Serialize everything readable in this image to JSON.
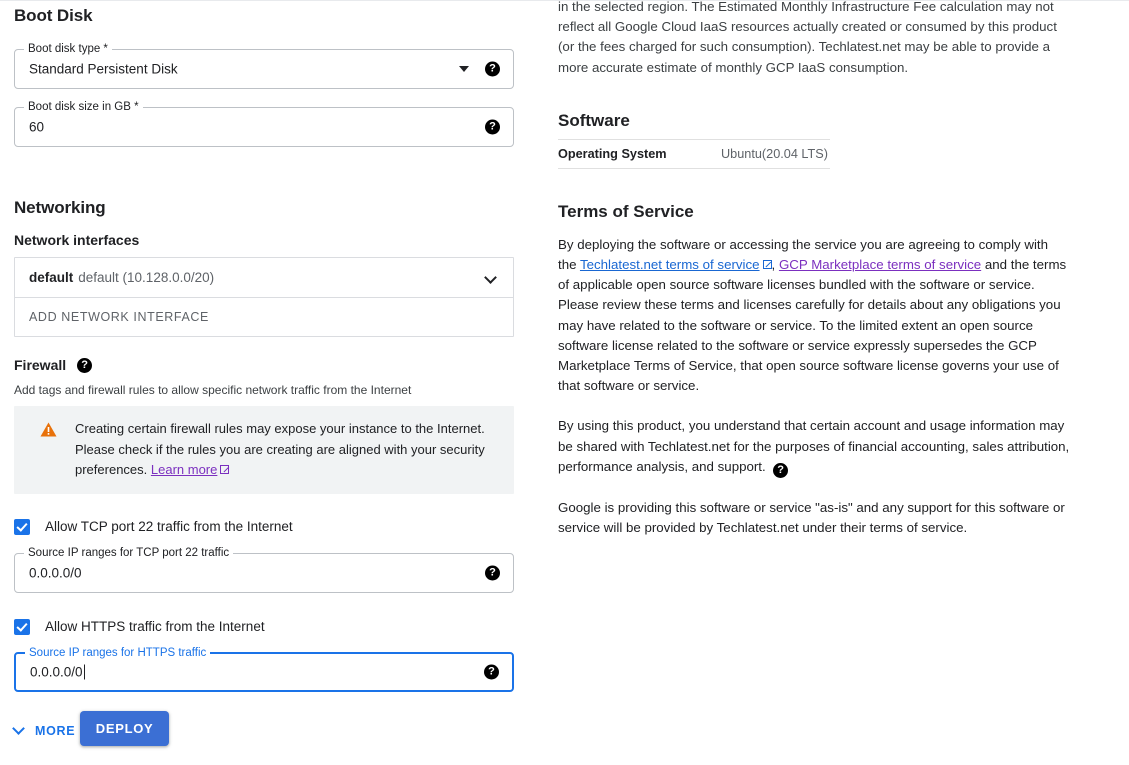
{
  "left": {
    "boot_disk": {
      "heading": "Boot Disk",
      "type_field": {
        "label": "Boot disk type *",
        "value": "Standard Persistent Disk",
        "help": "?"
      },
      "size_field": {
        "label": "Boot disk size in GB *",
        "value": "60",
        "help": "?"
      }
    },
    "networking": {
      "heading": "Networking",
      "interfaces_label": "Network interfaces",
      "interface_name": "default",
      "interface_detail": "default (10.128.0.0/20)",
      "add_interface_label": "ADD NETWORK INTERFACE",
      "firewall_label": "Firewall",
      "firewall_help": "?",
      "firewall_helper": "Add tags and firewall rules to allow specific network traffic from the Internet",
      "warning": {
        "text_before": "Creating certain firewall rules may expose your instance to the Internet. Please check if the rules you are creating are aligned with your security preferences.",
        "link_label": "Learn more"
      },
      "tcp_checkbox_label": "Allow TCP port 22 traffic from the Internet",
      "tcp_field": {
        "label": "Source IP ranges for TCP port 22 traffic",
        "value": "0.0.0.0/0",
        "help": "?"
      },
      "https_checkbox_label": "Allow HTTPS traffic from the Internet",
      "https_field": {
        "label": "Source IP ranges for HTTPS traffic",
        "value": "0.0.0.0/0",
        "help": "?"
      }
    },
    "more_label": "MORE",
    "deploy_label": "DEPLOY"
  },
  "right": {
    "fee_paragraph": "in the selected region. The Estimated Monthly Infrastructure Fee calculation may not reflect all Google Cloud IaaS resources actually created or consumed by this product (or the fees charged for such consumption). Techlatest.net may be able to provide a more accurate estimate of monthly GCP IaaS consumption.",
    "software": {
      "heading": "Software",
      "rows": [
        {
          "key": "Operating System",
          "value": "Ubuntu(20.04 LTS)"
        }
      ]
    },
    "terms": {
      "heading": "Terms of Service",
      "p1_a": "By deploying the software or accessing the service you are agreeing to comply with the ",
      "link1": "Techlatest.net terms of service",
      "p1_b": ", ",
      "link2": "GCP Marketplace terms of service",
      "p1_c": " and the terms of applicable open source software licenses bundled with the software or service. Please review these terms and licenses carefully for details about any obligations you may have related to the software or service. To the limited extent an open source software license related to the software or service expressly supersedes the GCP Marketplace Terms of Service, that open source software license governs your use of that software or service.",
      "p2": "By using this product, you understand that certain account and usage information may be shared with Techlatest.net for the purposes of financial accounting, sales attribution, performance analysis, and support.",
      "p2_help": "?",
      "p3": "Google is providing this software or service \"as-is\" and any support for this software or service will be provided by Techlatest.net under their terms of service."
    }
  },
  "colors": {
    "accent_blue": "#1a73e8",
    "button_blue": "#3b6fd4",
    "visited_purple": "#7b2fbf",
    "warning_orange": "#e8710a",
    "banner_gray": "#f1f3f4"
  }
}
